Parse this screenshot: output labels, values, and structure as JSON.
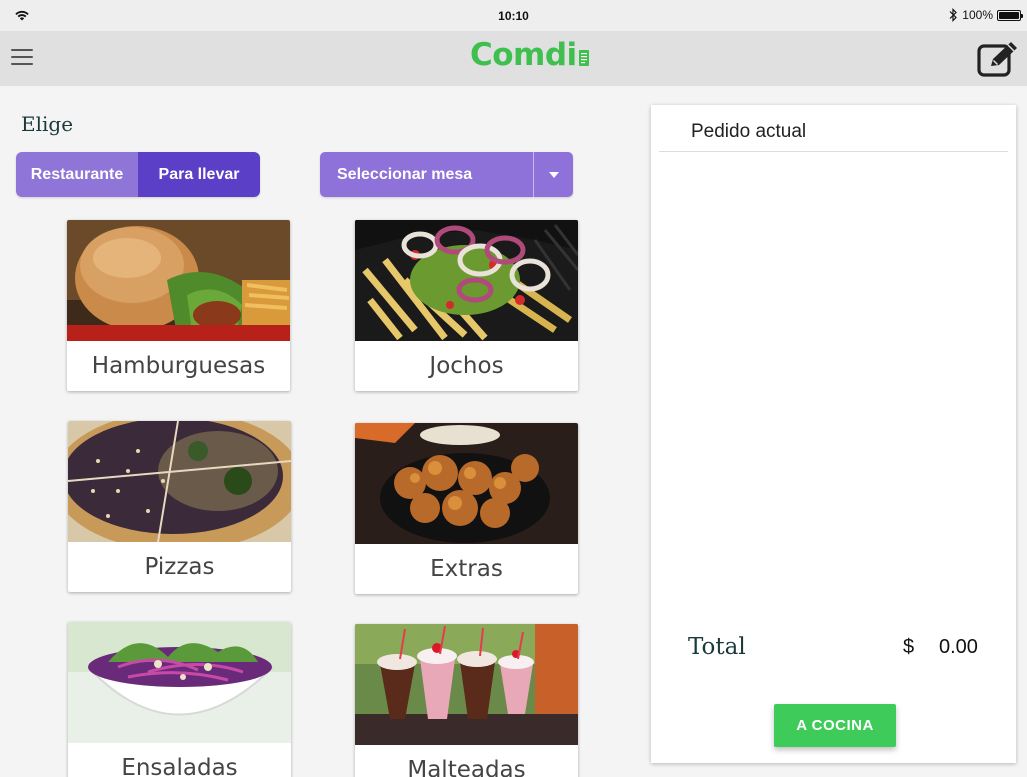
{
  "status_bar": {
    "time": "10:10",
    "battery": "100%"
  },
  "app_bar": {
    "logo_text": "Comdi",
    "brand_color": "#3fbf4e"
  },
  "left": {
    "heading": "Elige",
    "mode_toggle": {
      "options": [
        "Restaurante",
        "Para llevar"
      ],
      "selected": "Para llevar"
    },
    "table_select": {
      "label": "Seleccionar mesa"
    },
    "categories": [
      {
        "label": "Hamburguesas"
      },
      {
        "label": "Jochos"
      },
      {
        "label": "Pizzas"
      },
      {
        "label": "Extras"
      },
      {
        "label": "Ensaladas"
      },
      {
        "label": "Malteadas"
      }
    ]
  },
  "order": {
    "title": "Pedido actual",
    "total_label": "Total",
    "currency": "$",
    "total_amount": "0.00",
    "submit_label": "A COCINA"
  },
  "colors": {
    "accent_purple": "#8f72d9",
    "selected_purple": "#5b3fc7",
    "submit_green": "#3fcb5a"
  }
}
